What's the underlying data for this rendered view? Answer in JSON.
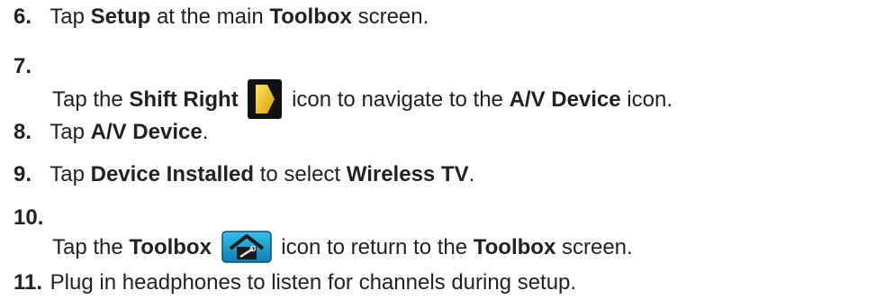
{
  "steps": [
    {
      "number": "6.",
      "parts": [
        "Tap ",
        "Setup",
        " at the main ",
        "Toolbox",
        " screen."
      ]
    },
    {
      "number": "7.",
      "before": "Tap the ",
      "bold1": "Shift Right",
      "icon": "shift-right-icon",
      "after": " icon to navigate to the ",
      "bold2": "A/V Device",
      "end": " icon."
    },
    {
      "number": "8.",
      "parts": [
        "Tap ",
        "A/V Device",
        "."
      ]
    },
    {
      "number": "9.",
      "parts": [
        "Tap ",
        "Device Installed",
        " to select ",
        "Wireless TV",
        "."
      ]
    },
    {
      "number": "10.",
      "before": "Tap the ",
      "bold1": "Toolbox",
      "icon": "toolbox-icon",
      "after": " icon to return to the ",
      "bold2": "Toolbox",
      "end": " screen."
    },
    {
      "number": "11.",
      "parts": [
        "Plug in headphones to listen for channels during setup."
      ]
    }
  ],
  "colors": {
    "text": "#222222",
    "shift_icon_yellow": "#f2c21b",
    "toolbox_icon_blue": "#1fa9d6"
  }
}
